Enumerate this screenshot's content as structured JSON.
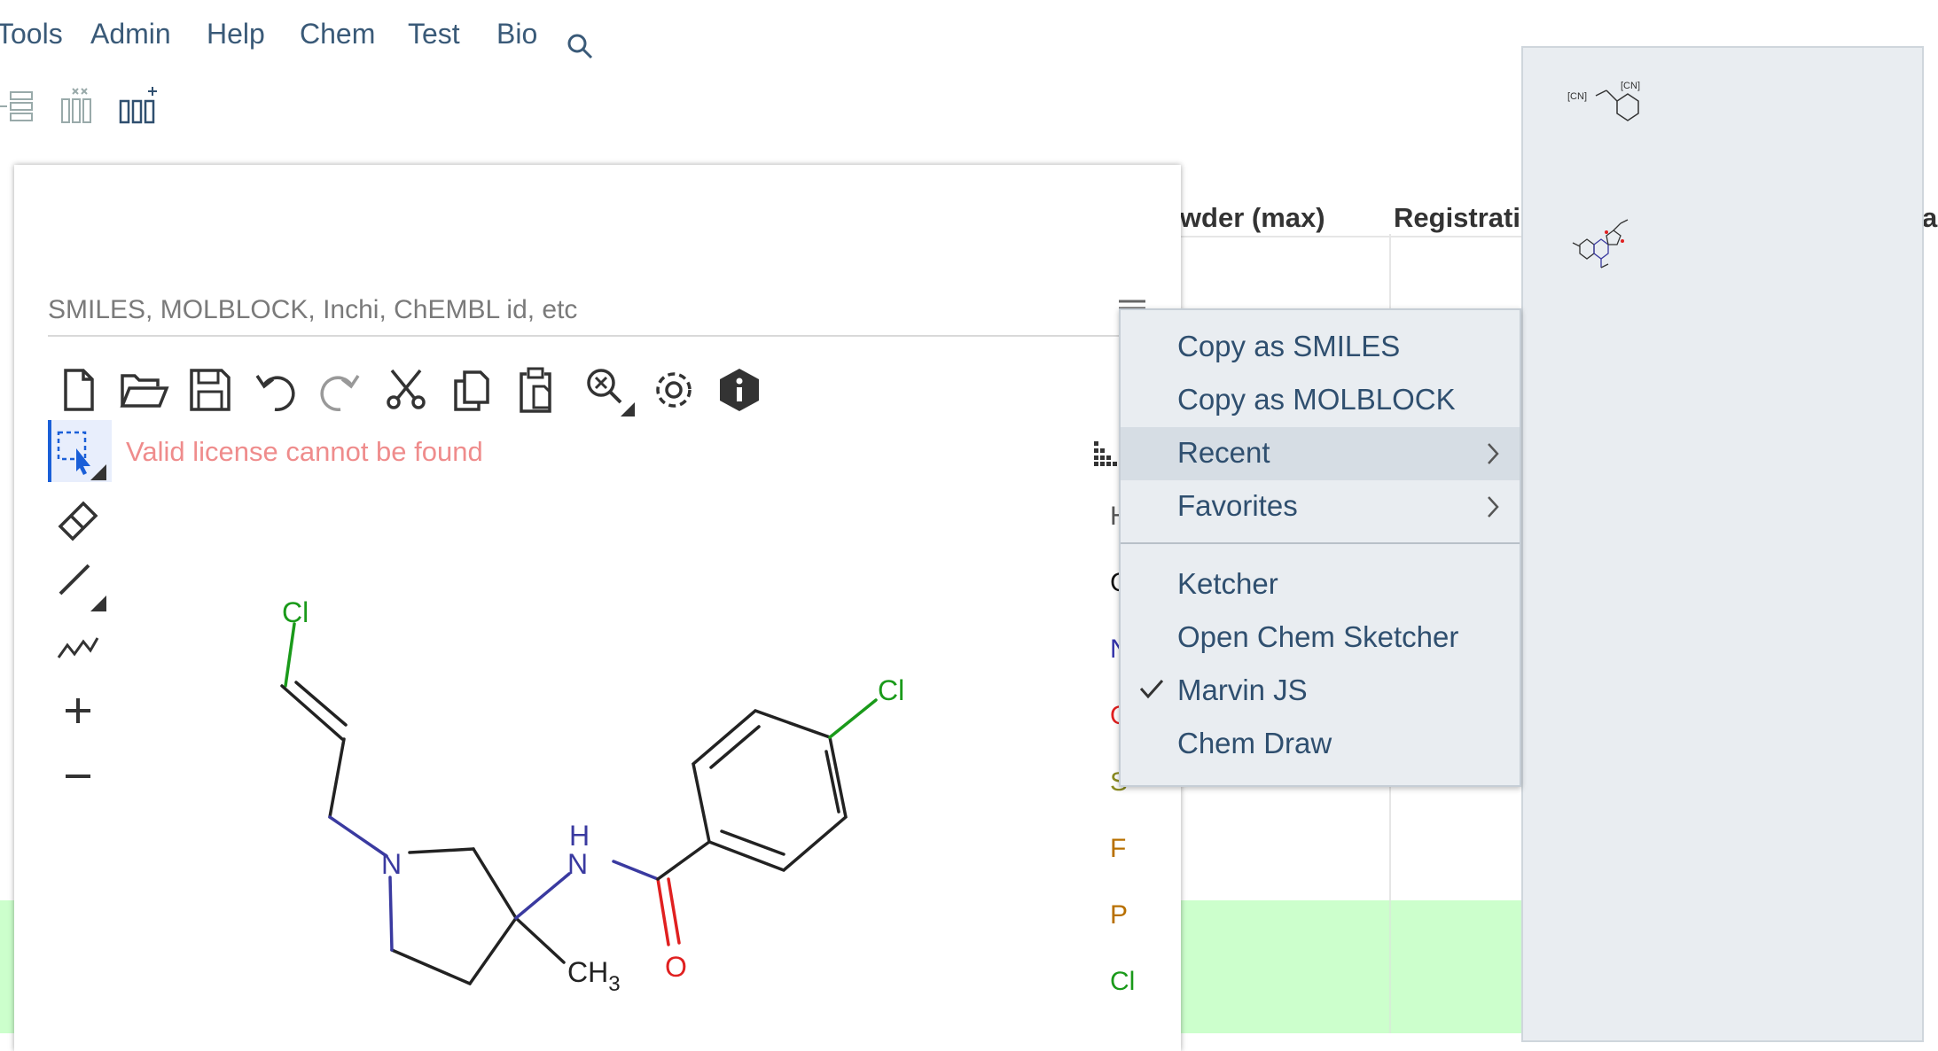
{
  "menu": {
    "items": [
      "Tools",
      "Admin",
      "Help",
      "Chem",
      "Test",
      "Bio"
    ],
    "search_icon": "search-icon"
  },
  "toolbar_icons": [
    "collapse-rows-icon",
    "remove-columns-icon",
    "add-columns-icon"
  ],
  "grid": {
    "headers": [
      "owder (max)",
      "Registratio",
      "a"
    ],
    "highlight_color": "#ccffcc"
  },
  "sketcher": {
    "input_placeholder": "SMILES, MOLBLOCK, Inchi, ChEMBL id, etc",
    "input_value": "",
    "menu_icon": "hamburger-icon",
    "toolbar": [
      "new-file-icon",
      "open-folder-icon",
      "save-icon",
      "undo-icon",
      "redo-icon",
      "cut-icon",
      "copy-icon",
      "paste-icon",
      "zoom-icon",
      "settings-icon",
      "info-icon"
    ],
    "side_tools": [
      "selection-icon",
      "eraser-icon",
      "bond-icon",
      "chain-icon",
      "zoom-in-icon",
      "zoom-out-icon"
    ],
    "license_warning": "Valid license cannot be found",
    "periodic_table_icon": "periodic-table-icon",
    "elements": [
      {
        "symbol": "H",
        "color": "#555555"
      },
      {
        "symbol": "C",
        "color": "#111111"
      },
      {
        "symbol": "N",
        "color": "#3333aa"
      },
      {
        "symbol": "O",
        "color": "#e02020"
      },
      {
        "symbol": "S",
        "color": "#8a8a20"
      },
      {
        "symbol": "F",
        "color": "#b87000"
      },
      {
        "symbol": "P",
        "color": "#b87000"
      },
      {
        "symbol": "Cl",
        "color": "#1a9a1a"
      }
    ],
    "molecule_labels": {
      "cl_top": "Cl",
      "cl_right": "Cl",
      "n_ring": "N",
      "nh_h": "H",
      "nh_n": "N",
      "methyl": "CH",
      "methyl_sub": "3",
      "oxygen": "O"
    }
  },
  "context_menu": {
    "copy_smiles": "Copy as SMILES",
    "copy_molblock": "Copy as MOLBLOCK",
    "recent": "Recent",
    "favorites": "Favorites",
    "sketchers": [
      "Ketcher",
      "Open Chem Sketcher",
      "Marvin JS",
      "Chem Draw"
    ],
    "selected": "Marvin JS"
  },
  "side_panel": {
    "mol1_labels": [
      "[CN]",
      "[CN]"
    ],
    "thumbnail_icons": [
      "molecule-thumbnail-1",
      "molecule-thumbnail-2"
    ]
  }
}
